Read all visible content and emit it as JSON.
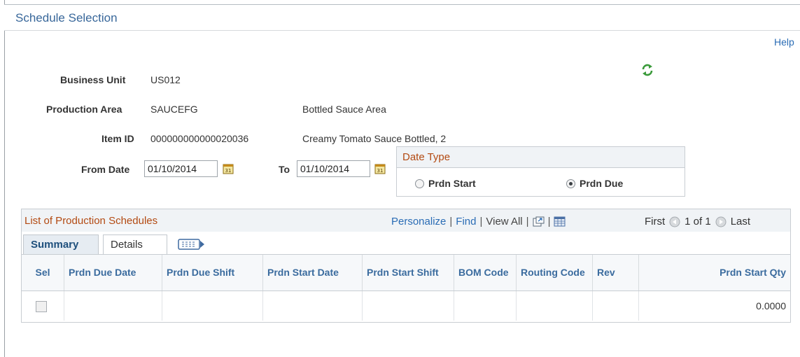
{
  "page": {
    "title": "Schedule Selection",
    "help_label": "Help"
  },
  "form": {
    "business_unit": {
      "label": "Business Unit",
      "value": "US012"
    },
    "production_area": {
      "label": "Production Area",
      "value": "SAUCEFG",
      "description": "Bottled Sauce Area"
    },
    "item_id": {
      "label": "Item ID",
      "value": "000000000000020036",
      "description": "Creamy Tomato Sauce Bottled, 2"
    },
    "from_date": {
      "label": "From Date",
      "value": "01/10/2014"
    },
    "to_date": {
      "label": "To",
      "value": "01/10/2014"
    }
  },
  "date_type": {
    "title": "Date Type",
    "options": [
      {
        "label": "Prdn Start",
        "checked": false
      },
      {
        "label": "Prdn Due",
        "checked": true
      }
    ]
  },
  "grid": {
    "title": "List of Production Schedules",
    "nav": {
      "personalize": "Personalize",
      "find": "Find",
      "view_all": "View All",
      "sep": "|"
    },
    "pager": {
      "first": "First",
      "range": "1 of 1",
      "last": "Last"
    },
    "tabs": [
      {
        "label": "Summary",
        "active": true
      },
      {
        "label": "Details",
        "active": false
      }
    ],
    "columns": [
      "Sel",
      "Prdn Due Date",
      "Prdn Due Shift",
      "Prdn Start Date",
      "Prdn Start Shift",
      "BOM Code",
      "Routing Code",
      "Rev",
      "Prdn Start Qty"
    ],
    "rows": [
      {
        "sel": false,
        "prdn_due_date": "",
        "prdn_due_shift": "",
        "prdn_start_date": "",
        "prdn_start_shift": "",
        "bom_code": "",
        "routing_code": "",
        "rev": "",
        "prdn_start_qty": "0.0000"
      }
    ]
  },
  "colors": {
    "title": "#38679a",
    "link": "#2a6cb5",
    "section_title": "#b34a12",
    "column_header": "#3a6b9e"
  }
}
